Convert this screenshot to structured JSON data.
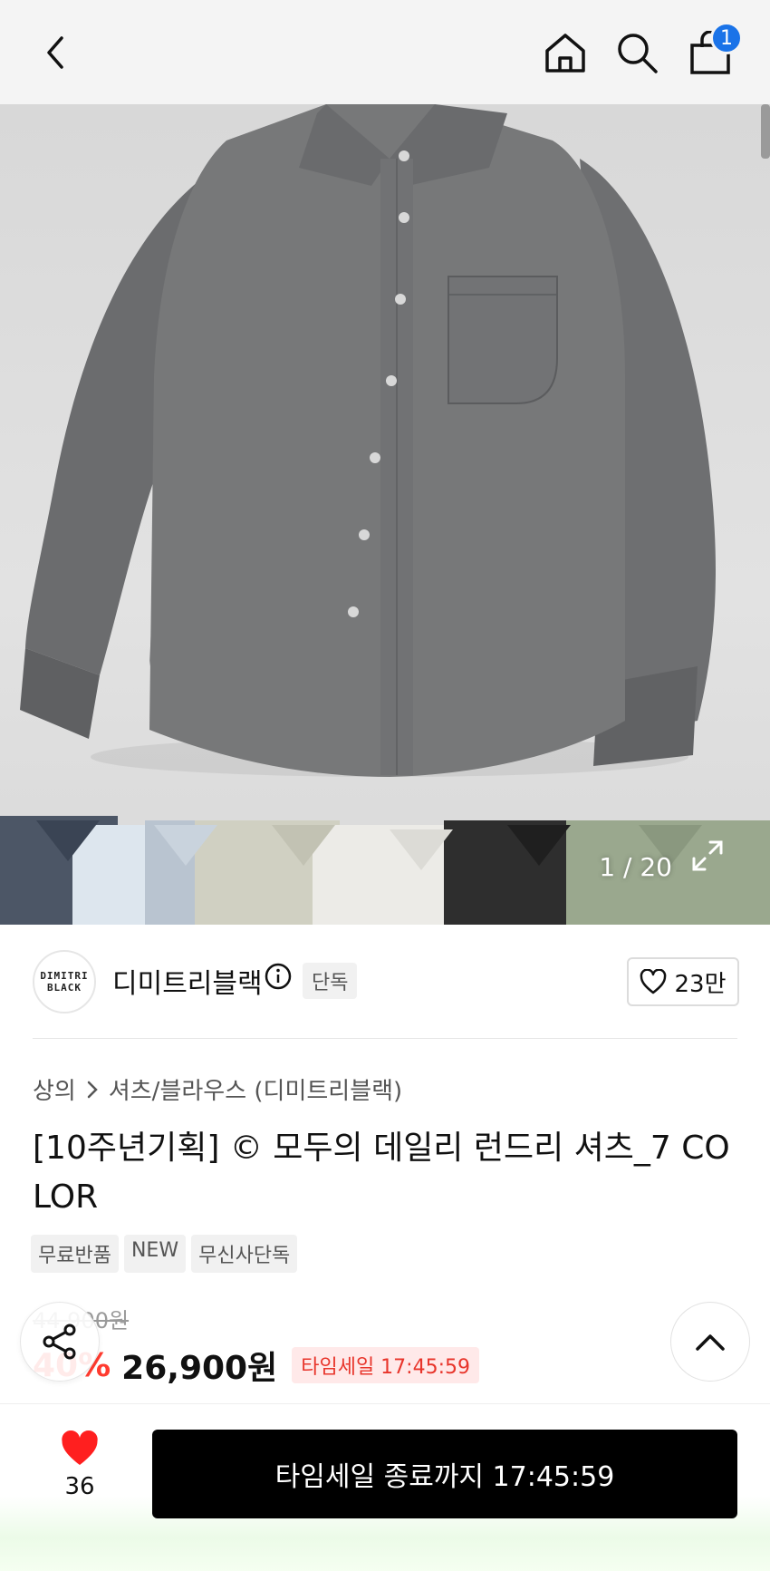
{
  "header": {
    "cart_count": "1"
  },
  "hero": {
    "counter": "1 / 20",
    "swatch_colors": [
      "#4c5666",
      "#dde6ee",
      "#b9c4d0",
      "#d0d0c2",
      "#ecebe7",
      "#2e2e2e",
      "#9aa88e"
    ]
  },
  "brand": {
    "logo_line1": "DIMITRI",
    "logo_line2": "BLACK",
    "name": "디미트리블랙",
    "exclusive": "단독",
    "likes": "23만"
  },
  "breadcrumb": {
    "category": "상의",
    "subcategory": "셔츠/블라우스 (디미트리블랙)"
  },
  "product": {
    "title": "[10주년기획] © 모두의 데일리 런드리 셔츠_7 COLOR",
    "tags": [
      "무료반품",
      "NEW",
      "무신사단독"
    ],
    "original_price": "44,900원",
    "discount": "40%",
    "price": "26,900원",
    "time_sale": "타임세일 17:45:59"
  },
  "bottom": {
    "fav_count": "36",
    "cta_label": "타임세일 종료까지 17:45:59"
  },
  "colors": {
    "accent_red": "#ff3b2f",
    "badge_blue": "#1a73e8",
    "cta_black": "#000000"
  }
}
